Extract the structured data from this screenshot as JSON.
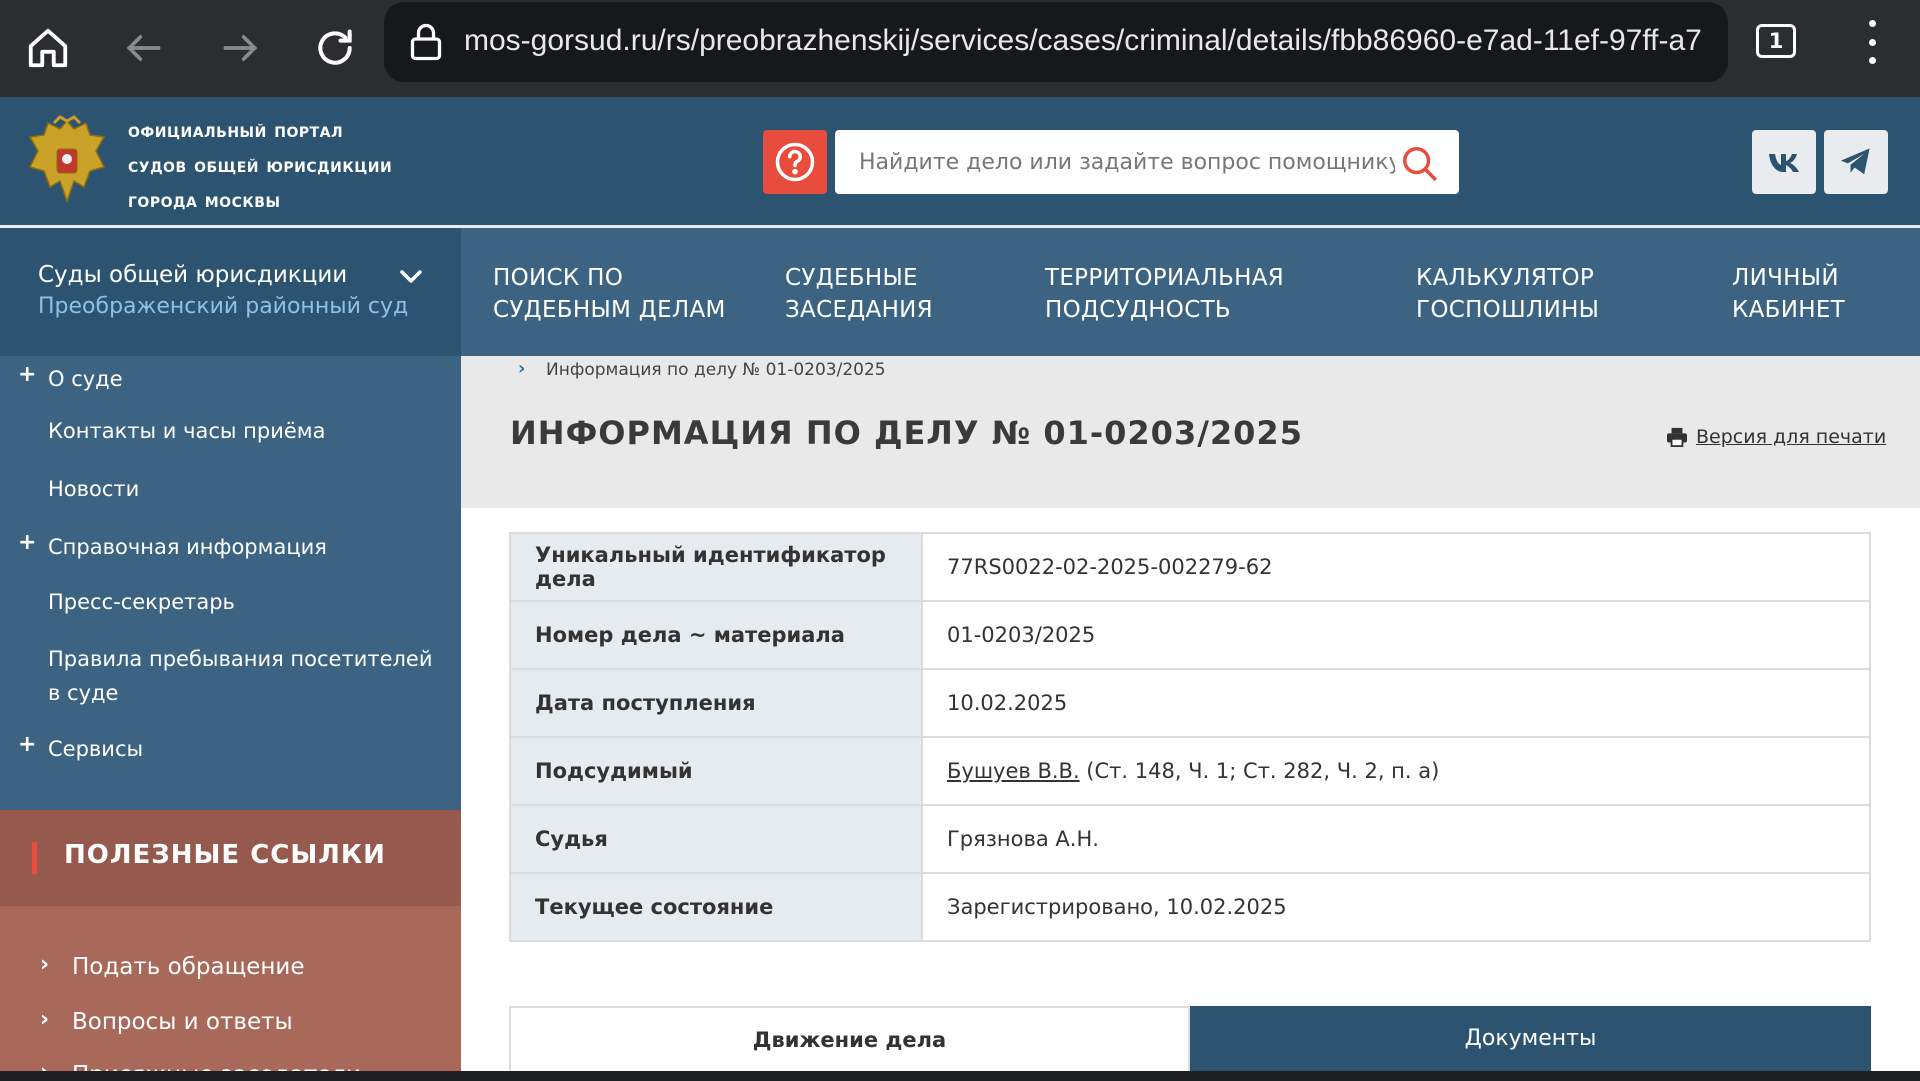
{
  "browser": {
    "url": "mos-gorsud.ru/rs/preobrazhenskij/services/cases/criminal/details/fbb86960-e7ad-11ef-97ff-a7",
    "tab_count": "1"
  },
  "header": {
    "portal_title": [
      "Официальный портал",
      "судов общей юрисдикции",
      "города Москвы"
    ],
    "search_placeholder": "Найдите дело или задайте вопрос помощнику"
  },
  "court_select": {
    "label": "Суды общей юрисдикции",
    "selected": "Преображенский районный суд"
  },
  "topnav": [
    {
      "line1": "ПОИСК ПО",
      "line2": "СУДЕБНЫМ ДЕЛАМ"
    },
    {
      "line1": "СУДЕБНЫЕ",
      "line2": "ЗАСЕДАНИЯ"
    },
    {
      "line1": "ТЕРРИТОРИАЛЬНАЯ",
      "line2": "ПОДСУДНОСТЬ"
    },
    {
      "line1": "КАЛЬКУЛЯТОР",
      "line2": "ГОСПОШЛИНЫ"
    },
    {
      "line1": "ЛИЧНЫЙ",
      "line2": "КАБИНЕТ"
    }
  ],
  "sidebar": {
    "items": [
      {
        "label": "О суде",
        "plus": "+"
      },
      {
        "label": "Контакты и часы приёма"
      },
      {
        "label": "Новости"
      },
      {
        "label": "Справочная информация",
        "plus": "+"
      },
      {
        "label": "Пресс-секретарь"
      },
      {
        "label": "Правила пребывания посетителей",
        "label2": "в суде"
      },
      {
        "label": "Сервисы",
        "plus": "+"
      }
    ]
  },
  "useful_links": {
    "title": "ПОЛЕЗНЫЕ ССЫЛКИ",
    "items": [
      "Подать обращение",
      "Вопросы и ответы",
      "Присяжные заседатели"
    ]
  },
  "main": {
    "breadcrumb": "Информация по делу № 01-0203/2025",
    "title": "ИНФОРМАЦИЯ ПО ДЕЛУ № 01-0203/2025",
    "print_label": "Версия для печати",
    "rows": [
      {
        "key": "Уникальный идентификатор дела",
        "value": "77RS0022-02-2025-002279-62"
      },
      {
        "key": "Номер дела ~ материала",
        "value": "01-0203/2025"
      },
      {
        "key": "Дата поступления",
        "value": "10.02.2025"
      },
      {
        "key": "Подсудимый",
        "link": "Бушуев В.В.",
        "value": " (Ст. 148, Ч. 1; Ст. 282, Ч. 2, п. а)"
      },
      {
        "key": "Судья",
        "value": "Грязнова А.Н."
      },
      {
        "key": "Текущее состояние",
        "value": "Зарегистрировано, 10.02.2025"
      }
    ],
    "tabs": {
      "left": "Движение дела",
      "right": "Документы"
    }
  },
  "colors": {
    "header_bg": "#2c5471",
    "nav_bg": "#3c6382",
    "accent_red": "#e74c3c",
    "useful_head_bg": "#955a4d",
    "useful_list_bg": "#a8695b"
  }
}
